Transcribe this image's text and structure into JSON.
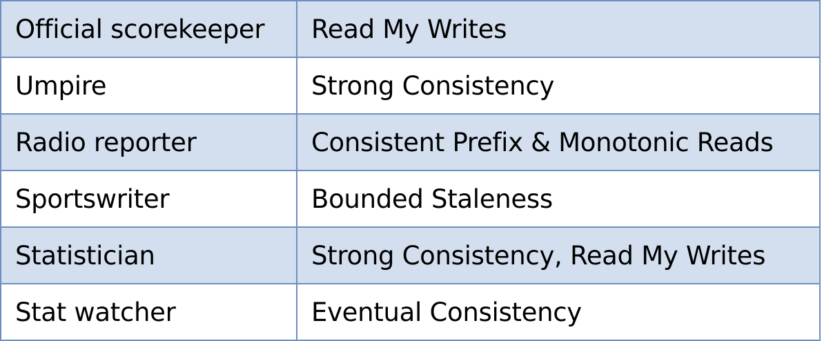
{
  "rows": [
    {
      "role": "Official scorekeeper",
      "consistency": "Read My Writes"
    },
    {
      "role": "Umpire",
      "consistency": "Strong Consistency"
    },
    {
      "role": "Radio reporter",
      "consistency": "Consistent Prefix & Monotonic Reads"
    },
    {
      "role": "Sportswriter",
      "consistency": "Bounded Staleness"
    },
    {
      "role": "Statistician",
      "consistency": "Strong Consistency, Read My Writes"
    },
    {
      "role": "Stat watcher",
      "consistency": "Eventual Consistency"
    }
  ],
  "colors": {
    "border": "#6d8fc0",
    "band": "#d3dfee",
    "white": "#ffffff"
  }
}
